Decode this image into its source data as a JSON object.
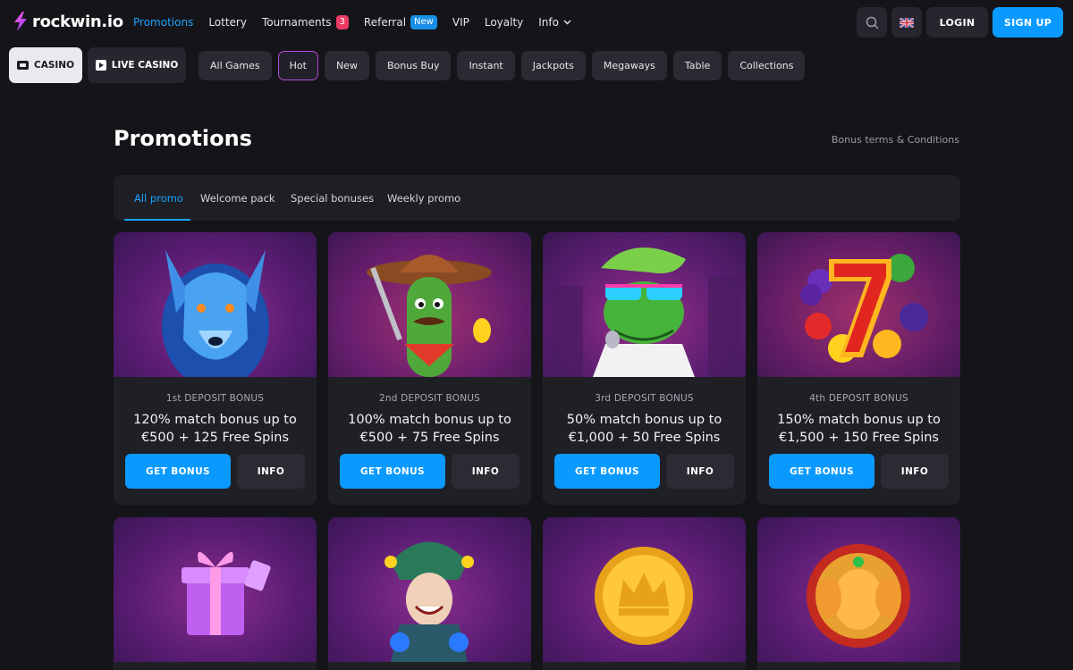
{
  "brand": {
    "name": "rockwin.io"
  },
  "nav": {
    "items": [
      {
        "label": "Promotions",
        "active": true
      },
      {
        "label": "Lottery"
      },
      {
        "label": "Tournaments",
        "badge": "3"
      },
      {
        "label": "Referral",
        "badge": "New"
      },
      {
        "label": "VIP"
      },
      {
        "label": "Loyalty"
      },
      {
        "label": "Info"
      }
    ]
  },
  "header_actions": {
    "login": "LOGIN",
    "signup": "SIGN UP"
  },
  "main_tabs": {
    "casino": "CASINO",
    "live_casino": "LIVE CASINO"
  },
  "categories": [
    "All Games",
    "Hot",
    "New",
    "Bonus Buy",
    "Instant",
    "Jackpots",
    "Megaways",
    "Table",
    "Collections"
  ],
  "page": {
    "title": "Promotions",
    "terms_link": "Bonus terms & Conditions"
  },
  "promo_tabs": [
    "All promo",
    "Welcome pack",
    "Special bonuses",
    "Weekly promo"
  ],
  "cards": [
    {
      "label": "1st DEPOSIT BONUS",
      "line1": "120% match bonus up to",
      "line2": "€500 + 125 Free Spins",
      "get": "GET BONUS",
      "info": "INFO",
      "art": "wolf"
    },
    {
      "label": "2nd DEPOSIT BONUS",
      "line1": "100% match bonus up to",
      "line2": "€500 + 75 Free Spins",
      "get": "GET BONUS",
      "info": "INFO",
      "art": "cactus"
    },
    {
      "label": "3rd DEPOSIT BONUS",
      "line1": "50% match bonus up to",
      "line2": "€1,000 + 50 Free Spins",
      "get": "GET BONUS",
      "info": "INFO",
      "art": "frog"
    },
    {
      "label": "4th DEPOSIT BONUS",
      "line1": "150% match bonus up to",
      "line2": "€1,500 + 150 Free Spins",
      "get": "GET BONUS",
      "info": "INFO",
      "art": "seven"
    },
    {
      "art": "gift"
    },
    {
      "art": "jester"
    },
    {
      "art": "coin"
    },
    {
      "art": "elephant"
    }
  ],
  "colors": {
    "background": "#141419",
    "accent": "#0a9aff",
    "active_link": "#1fa3ff",
    "badge_red": "#ec3b63",
    "hot_border": "#b24ad6"
  }
}
